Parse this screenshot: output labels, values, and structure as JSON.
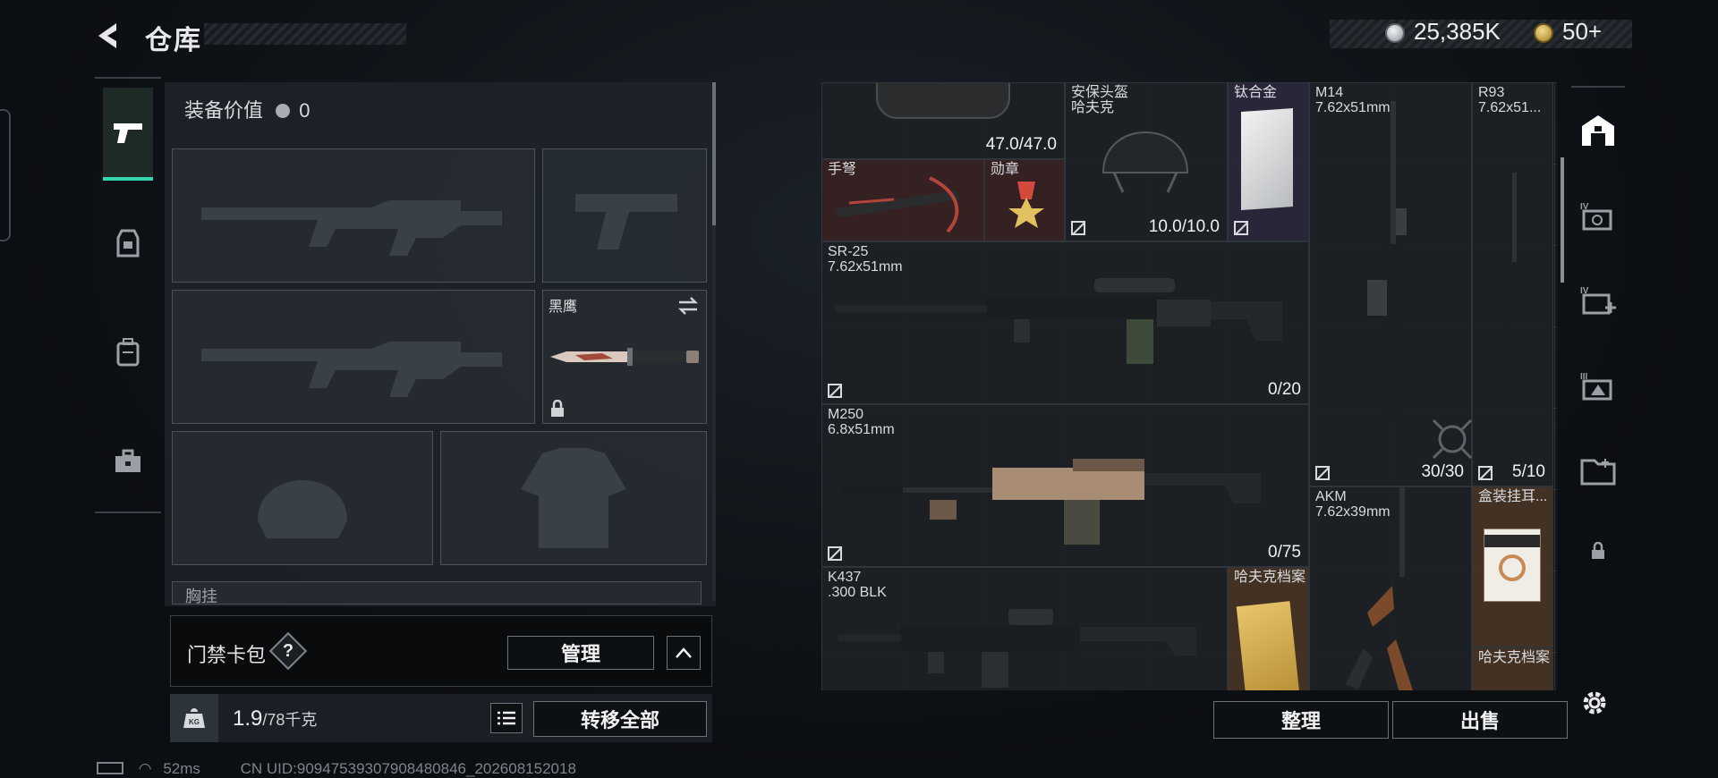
{
  "header": {
    "title": "仓库"
  },
  "currency": {
    "silver": "25,385K",
    "gold": "50+",
    "silver_color": "#c8ccd0",
    "gold_color": "#c9a94a"
  },
  "sidebar": {
    "items": [
      {
        "icon": "pistol-icon",
        "active": true
      },
      {
        "icon": "helmet-armor-icon",
        "active": false
      },
      {
        "icon": "backpack-icon",
        "active": false
      },
      {
        "icon": "toolbox-icon",
        "active": false
      }
    ]
  },
  "loadout": {
    "value_label": "装备价值",
    "value": "0",
    "melee_name": "黑鹰",
    "chest_rig_label": "胸挂"
  },
  "keycard": {
    "label": "门禁卡包",
    "help": "?",
    "manage_label": "管理"
  },
  "weight": {
    "current": "1.9",
    "max": "/78千克",
    "transfer_all_label": "转移全部"
  },
  "status": {
    "ping": "52ms",
    "uid": "CN UID:909475393079084808​46_202608152018"
  },
  "storage": {
    "items": [
      {
        "key": "armor",
        "count": "47.0/47.0"
      },
      {
        "key": "helmet",
        "name": "安保头盔",
        "sub": "哈夫克",
        "count": "10.0/10.0"
      },
      {
        "key": "titanium",
        "name": "钛合金"
      },
      {
        "key": "m14",
        "name": "M14",
        "sub": "7.62x51mm"
      },
      {
        "key": "r93",
        "name": "R93",
        "sub": "7.62x51..."
      },
      {
        "key": "crossbow",
        "name": "手弩"
      },
      {
        "key": "medal",
        "name": "勋章"
      },
      {
        "key": "sr25",
        "name": "SR-25",
        "sub": "7.62x51mm",
        "count": "0/20"
      },
      {
        "key": "m14-count",
        "count": "30/30"
      },
      {
        "key": "r93-count",
        "count": "5/10"
      },
      {
        "key": "m250",
        "name": "M250",
        "sub": "6.8x51mm",
        "count": "0/75"
      },
      {
        "key": "akm",
        "name": "AKM",
        "sub": "7.62x39mm"
      },
      {
        "key": "earbox",
        "name": "盒装挂耳..."
      },
      {
        "key": "k437",
        "name": "K437",
        "sub": ".300 BLK"
      },
      {
        "key": "archive1",
        "name": "哈夫克档案"
      },
      {
        "key": "archive2",
        "name": "哈夫克档案"
      }
    ],
    "sort_label": "整理",
    "sell_label": "出售"
  },
  "right_rail": {
    "items": [
      "storage-home-icon",
      "iv-expand-icon",
      "iv-add-icon",
      "iii-expand-icon",
      "folder-icon",
      "lock-icon"
    ],
    "settings_icon": "gear-icon"
  }
}
